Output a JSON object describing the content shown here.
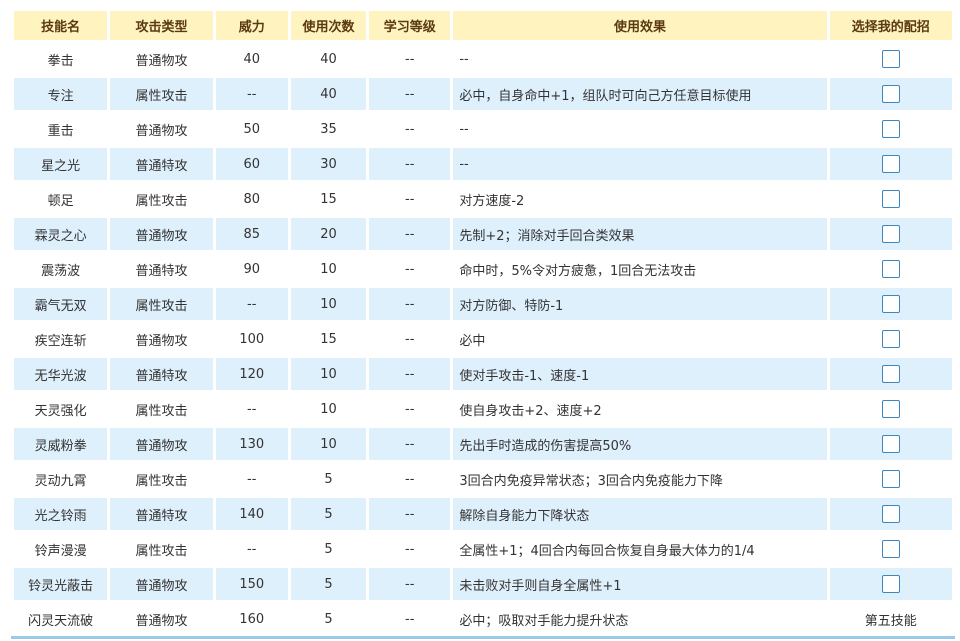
{
  "headers": [
    "技能名",
    "攻击类型",
    "威力",
    "使用次数",
    "学习等级",
    "使用效果",
    "选择我的配招"
  ],
  "skills": [
    {
      "name": "拳击",
      "type": "普通物攻",
      "power": "40",
      "pp": "40",
      "level": "--",
      "effect": "--"
    },
    {
      "name": "专注",
      "type": "属性攻击",
      "power": "--",
      "pp": "40",
      "level": "--",
      "effect": "必中，自身命中+1，组队时可向己方任意目标使用"
    },
    {
      "name": "重击",
      "type": "普通物攻",
      "power": "50",
      "pp": "35",
      "level": "--",
      "effect": "--"
    },
    {
      "name": "星之光",
      "type": "普通特攻",
      "power": "60",
      "pp": "30",
      "level": "--",
      "effect": "--"
    },
    {
      "name": "顿足",
      "type": "属性攻击",
      "power": "80",
      "pp": "15",
      "level": "--",
      "effect": "对方速度-2"
    },
    {
      "name": "霖灵之心",
      "type": "普通物攻",
      "power": "85",
      "pp": "20",
      "level": "--",
      "effect": "先制+2；消除对手回合类效果"
    },
    {
      "name": "震荡波",
      "type": "普通特攻",
      "power": "90",
      "pp": "10",
      "level": "--",
      "effect": "命中时，5%令对方疲惫，1回合无法攻击"
    },
    {
      "name": "霸气无双",
      "type": "属性攻击",
      "power": "--",
      "pp": "10",
      "level": "--",
      "effect": "对方防御、特防-1"
    },
    {
      "name": "疾空连斩",
      "type": "普通物攻",
      "power": "100",
      "pp": "15",
      "level": "--",
      "effect": "必中"
    },
    {
      "name": "无华光波",
      "type": "普通特攻",
      "power": "120",
      "pp": "10",
      "level": "--",
      "effect": "使对手攻击-1、速度-1"
    },
    {
      "name": "天灵强化",
      "type": "属性攻击",
      "power": "--",
      "pp": "10",
      "level": "--",
      "effect": "使自身攻击+2、速度+2"
    },
    {
      "name": "灵威粉拳",
      "type": "普通物攻",
      "power": "130",
      "pp": "10",
      "level": "--",
      "effect": "先出手时造成的伤害提高50%"
    },
    {
      "name": "灵动九霄",
      "type": "属性攻击",
      "power": "--",
      "pp": "5",
      "level": "--",
      "effect": "3回合内免疫异常状态；3回合内免疫能力下降"
    },
    {
      "name": "光之铃雨",
      "type": "普通特攻",
      "power": "140",
      "pp": "5",
      "level": "--",
      "effect": "解除自身能力下降状态"
    },
    {
      "name": "铃声漫漫",
      "type": "属性攻击",
      "power": "--",
      "pp": "5",
      "level": "--",
      "effect": "全属性+1；4回合内每回合恢复自身最大体力的1/4"
    },
    {
      "name": "铃灵光蔽击",
      "type": "普通物攻",
      "power": "150",
      "pp": "5",
      "level": "--",
      "effect": "未击败对手则自身全属性+1"
    },
    {
      "name": "闪灵天流破",
      "type": "普通物攻",
      "power": "160",
      "pp": "5",
      "level": "--",
      "effect": "必中；吸取对手能力提升状态",
      "select_text": "第五技能"
    }
  ]
}
